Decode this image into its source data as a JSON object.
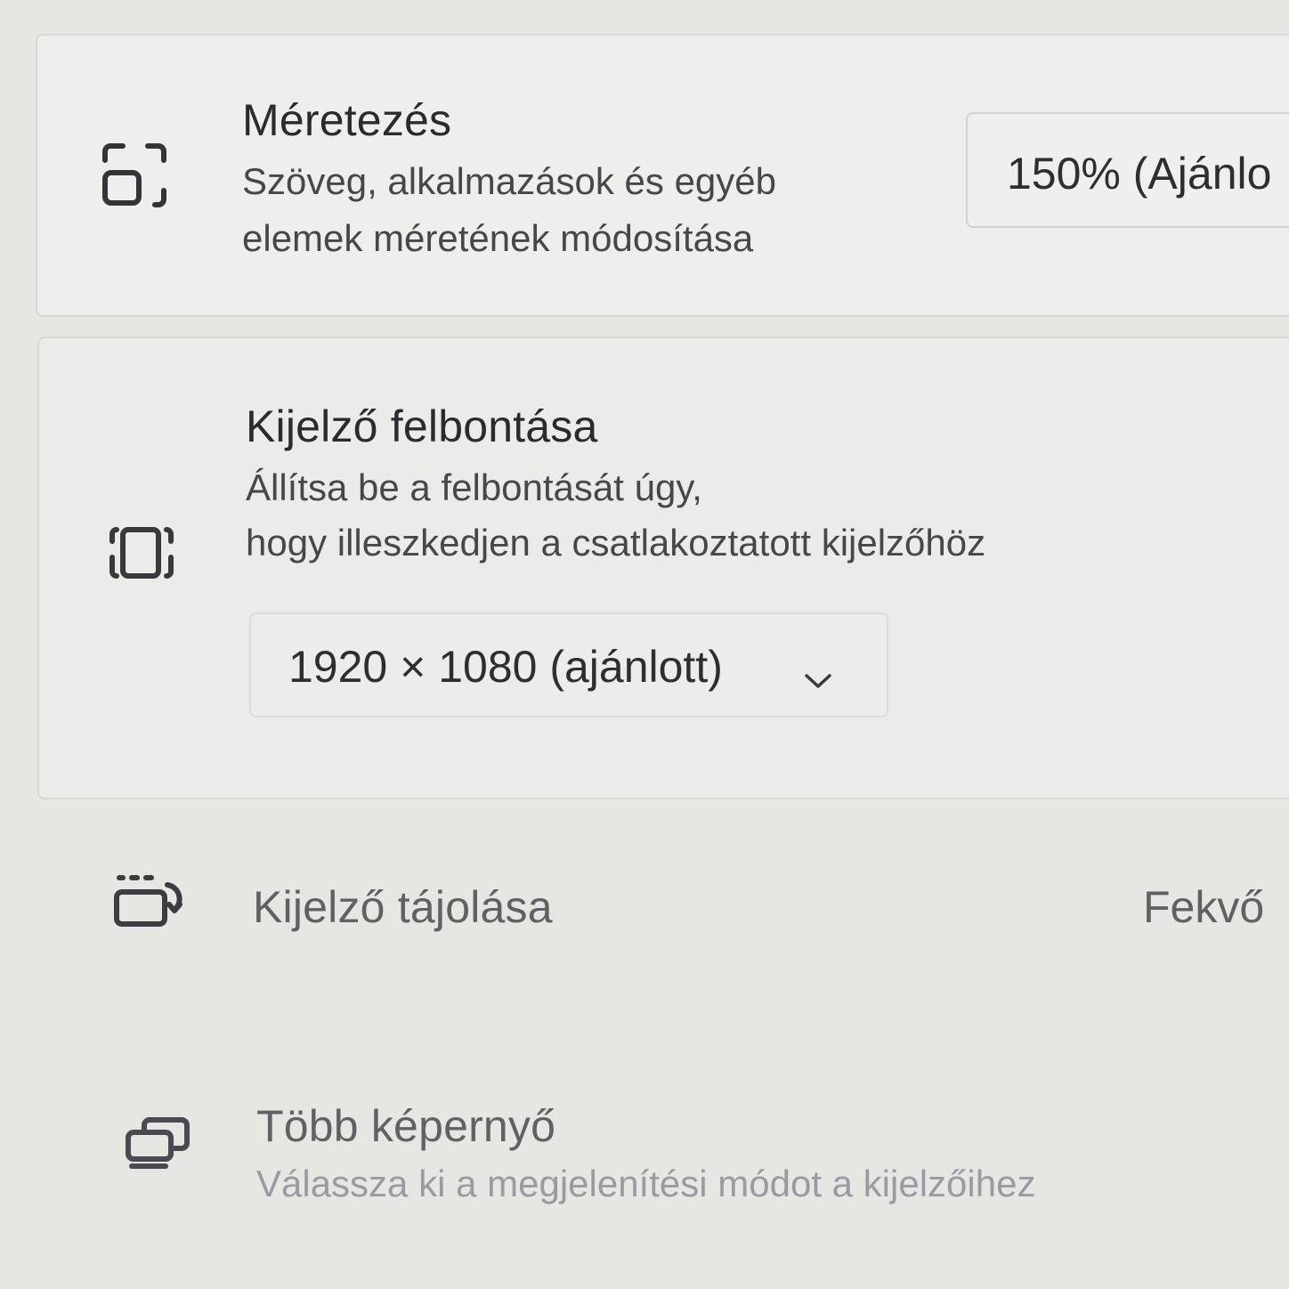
{
  "scale": {
    "title": "Méretezés",
    "desc_line1": "Szöveg, alkalmazások és egyéb",
    "desc_line2": "elemek méretének módosítása",
    "value": "150% (Ajánlo",
    "icon": "scale-icon"
  },
  "resolution": {
    "title": "Kijelző felbontása",
    "desc_line1": "Állítsa be a felbontását úgy,",
    "desc_line2": "hogy illeszkedjen a csatlakoztatott kijelzőhöz",
    "value": "1920 × 1080 (ajánlott)",
    "icon": "resolution-icon"
  },
  "orientation": {
    "title": "Kijelző tájolása",
    "value": "Fekvő",
    "icon": "orientation-icon"
  },
  "multiple_displays": {
    "title": "Több képernyő",
    "desc": "Válassza ki a megjelenítési módot a kijelzőihez",
    "icon": "multiple-displays-icon"
  }
}
